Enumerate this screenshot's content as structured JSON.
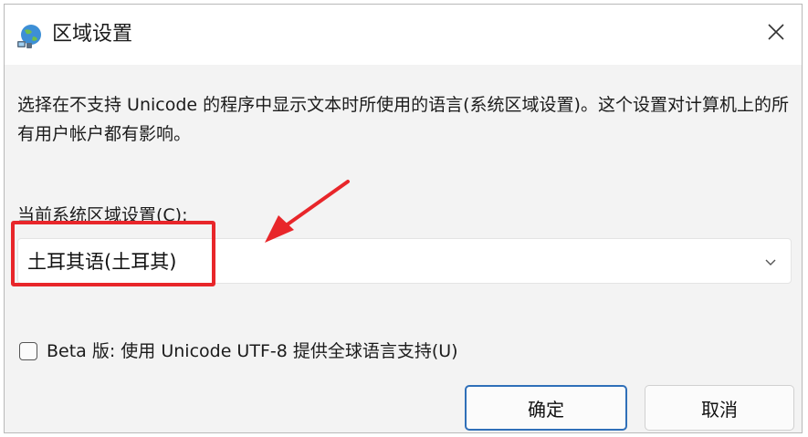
{
  "window": {
    "title": "区域设置",
    "icon": "globe-network-icon",
    "close_icon": "close-icon"
  },
  "content": {
    "description": "选择在不支持 Unicode 的程序中显示文本时所使用的语言(系统区域设置)。这个设置对计算机上的所有用户帐户都有影响。",
    "current_locale_label": "当前系统区域设置(C):",
    "current_locale_value": "土耳其语(土耳其)",
    "dropdown_icon": "chevron-down-icon",
    "beta_checkbox_label": "Beta 版: 使用 Unicode UTF-8 提供全球语言支持(U)",
    "beta_checked": false
  },
  "buttons": {
    "ok_label": "确定",
    "cancel_label": "取消"
  },
  "annotations": {
    "highlight_color": "#e8262a",
    "arrow_color": "#e8262a"
  },
  "colors": {
    "titlebar_bg": "#ffffff",
    "dialog_bg": "#f3f3f3",
    "accent_border": "#2f6fb8"
  }
}
